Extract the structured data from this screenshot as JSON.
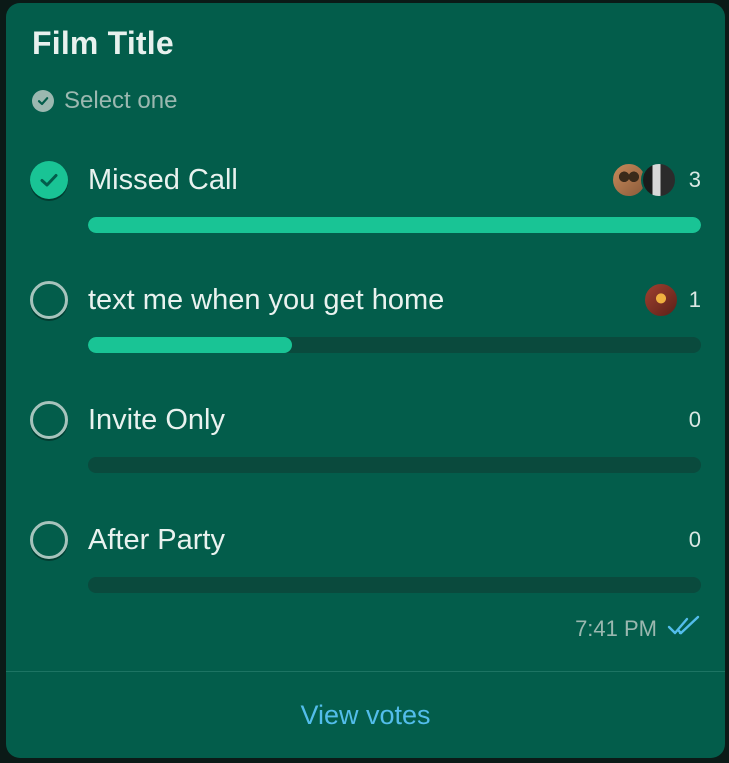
{
  "poll": {
    "title": "Film Title",
    "subtitle": "Select one",
    "options": [
      {
        "label": "Missed Call",
        "count": "3",
        "checked": true,
        "fraction": 1.0
      },
      {
        "label": "text me when you get home",
        "count": "1",
        "checked": false,
        "fraction": 0.333
      },
      {
        "label": "Invite Only",
        "count": "0",
        "checked": false,
        "fraction": 0
      },
      {
        "label": "After Party",
        "count": "0",
        "checked": false,
        "fraction": 0
      }
    ],
    "time": "7:41 PM",
    "view_votes_label": "View votes"
  },
  "colors": {
    "card_bg": "#035d4b",
    "accent": "#19c495",
    "bar_track": "#0a4a3d",
    "link": "#53bdeb",
    "read_ticks": "#53bdeb"
  }
}
